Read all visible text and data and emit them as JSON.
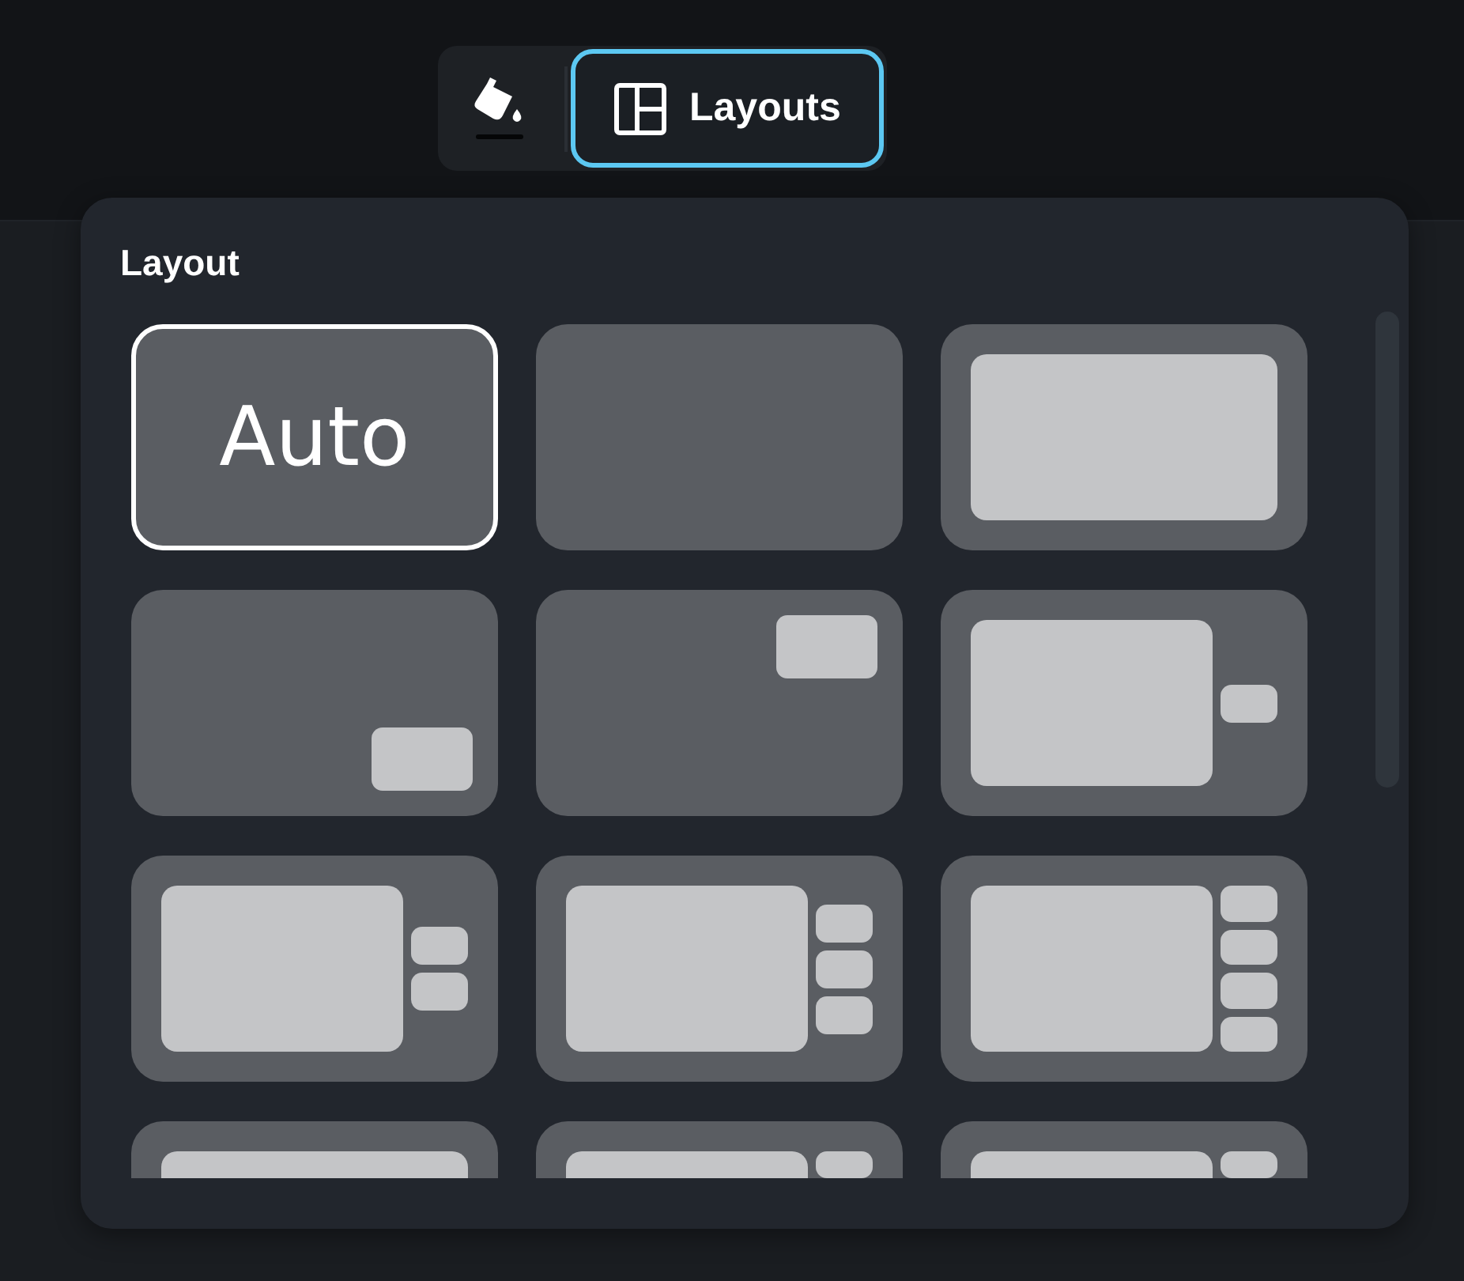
{
  "toolbar": [
    {
      "kind": "paint",
      "selected": false
    },
    {
      "kind": "layouts",
      "label": "Layouts",
      "selected": true
    }
  ],
  "popover": {
    "title": "Layout",
    "layouts": [
      {
        "kind": "auto",
        "label": "Auto",
        "selected": true
      },
      {
        "kind": "blank",
        "selected": false
      },
      {
        "kind": "full",
        "selected": false
      },
      {
        "kind": "pip-bottom",
        "selected": false
      },
      {
        "kind": "pip-top",
        "selected": false
      },
      {
        "kind": "main-one",
        "selected": false
      },
      {
        "kind": "main-two",
        "selected": false
      },
      {
        "kind": "main-three",
        "selected": false
      },
      {
        "kind": "main-four",
        "selected": false
      },
      {
        "kind": "main-only",
        "selected": false
      },
      {
        "kind": "main-five",
        "selected": false
      },
      {
        "kind": "main-five",
        "selected": false
      }
    ]
  }
}
